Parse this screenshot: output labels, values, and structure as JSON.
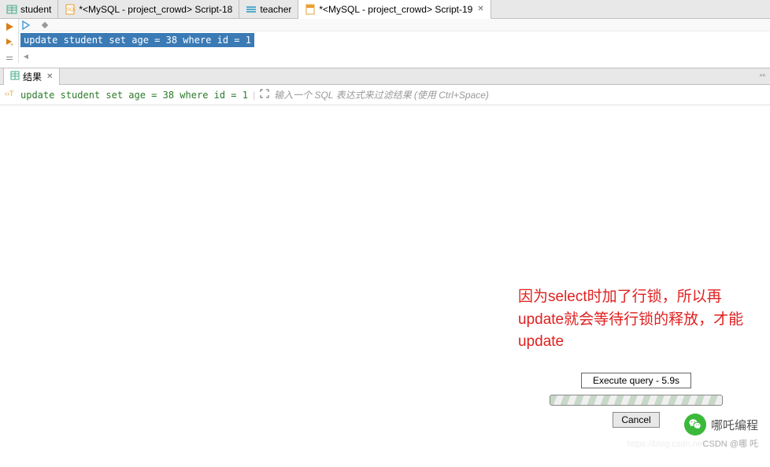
{
  "tabs": [
    {
      "label": "student",
      "icon": "table"
    },
    {
      "label": "*<MySQL - project_crowd> Script-18",
      "icon": "sql"
    },
    {
      "label": "teacher",
      "icon": "view"
    },
    {
      "label": "*<MySQL - project_crowd> Script-19",
      "icon": "sql-active",
      "active": true
    }
  ],
  "editor": {
    "sql": "update student set age = 38 where id = 1"
  },
  "results": {
    "tab_label": "结果",
    "query_text": "update student set age = 38 where id = 1",
    "filter_placeholder": "输入一个 SQL 表达式来过滤结果 (使用 Ctrl+Space)"
  },
  "annotation": {
    "text": "因为select时加了行锁，所以再update就会等待行锁的释放，才能update"
  },
  "progress": {
    "label": "Execute query - 5.9s",
    "cancel": "Cancel"
  },
  "watermark": {
    "brand": "哪吒编程",
    "attrib": "CSDN @哪 吒",
    "url": "https://blog.csdn.net/"
  }
}
